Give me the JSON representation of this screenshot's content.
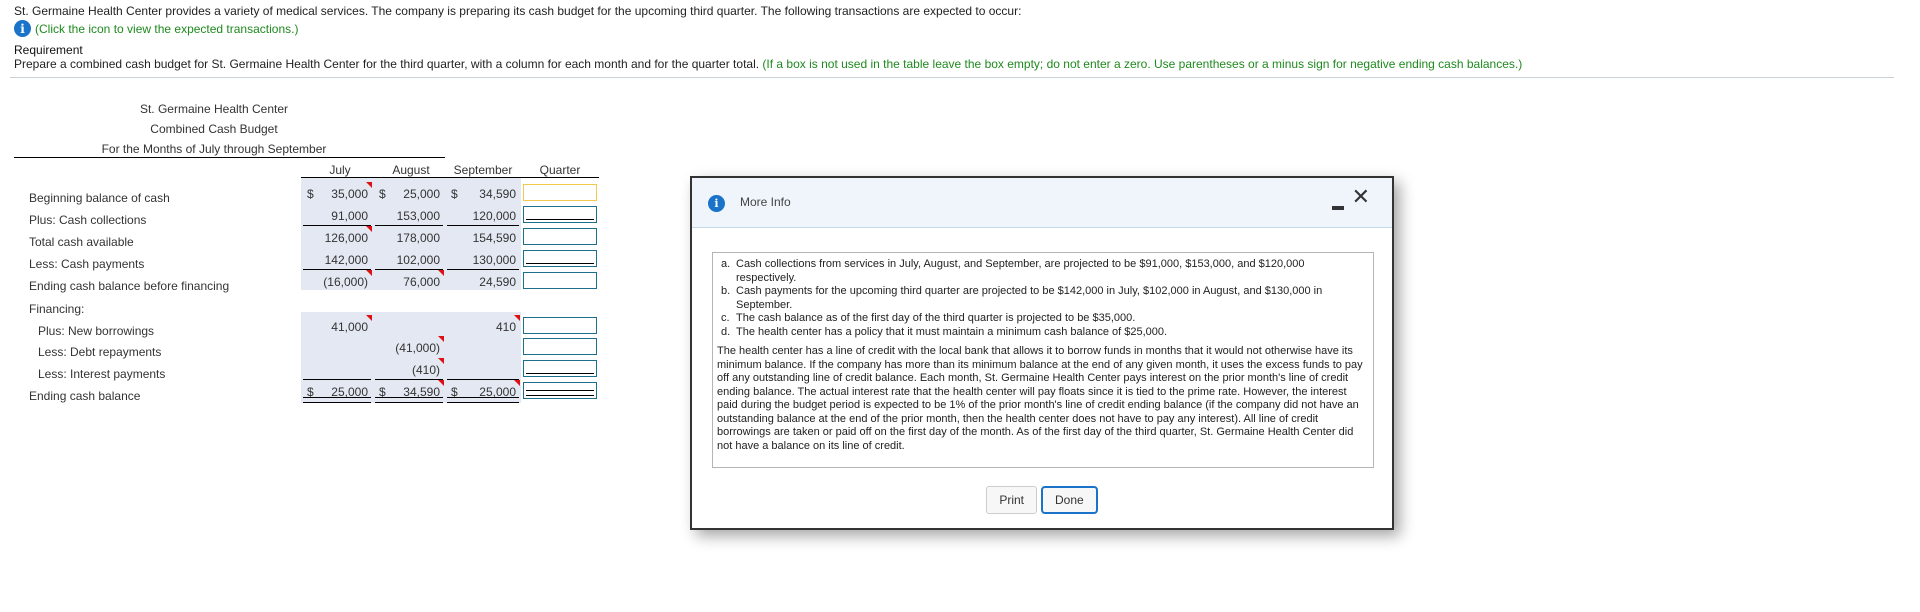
{
  "intro": {
    "text": "St. Germaine Health Center provides a variety of medical services. The company is preparing its cash budget for the upcoming third quarter. The following transactions are expected to occur:",
    "click_icon_text": "(Click the icon to view the expected transactions.)",
    "info_icon": "info-icon"
  },
  "requirement": {
    "title": "Requirement",
    "text": "Prepare a combined cash budget for St. Germaine Health Center for the third quarter, with a column for each month and for the quarter total.",
    "instruction": "(If a box is not used in the table leave the box empty; do not enter a zero. Use parentheses or a minus sign for negative ending cash balances.)",
    "accent_color": "#1e8a1e"
  },
  "budget": {
    "title1": "St. Germaine Health Center",
    "title2": "Combined Cash Budget",
    "title3": "For the Months of July through September",
    "columns": [
      "July",
      "August",
      "September",
      "Quarter"
    ],
    "rows": [
      {
        "label": "Beginning balance of cash",
        "dollar": true,
        "values": [
          "35,000",
          "25,000",
          "34,590"
        ],
        "quarter": ""
      },
      {
        "label": "Plus: Cash collections",
        "dollar": false,
        "values": [
          "91,000",
          "153,000",
          "120,000"
        ],
        "quarter": ""
      },
      {
        "label": "Total cash available",
        "dollar": false,
        "values": [
          "126,000",
          "178,000",
          "154,590"
        ],
        "quarter": ""
      },
      {
        "label": "Less: Cash payments",
        "dollar": false,
        "values": [
          "142,000",
          "102,000",
          "130,000"
        ],
        "quarter": ""
      },
      {
        "label": "Ending cash balance before financing",
        "dollar": false,
        "values": [
          "(16,000)",
          "76,000",
          "24,590"
        ],
        "quarter": ""
      },
      {
        "label": "Financing:"
      },
      {
        "label": "Plus: New borrowings",
        "dollar": false,
        "values": [
          "41,000",
          "",
          "410"
        ],
        "quarter": ""
      },
      {
        "label": "Less: Debt repayments",
        "dollar": false,
        "values": [
          "",
          "(41,000)",
          ""
        ],
        "quarter": ""
      },
      {
        "label": "Less: Interest payments",
        "dollar": false,
        "values": [
          "",
          "(410)",
          ""
        ],
        "quarter": ""
      },
      {
        "label": "Ending cash balance",
        "dollar": true,
        "values": [
          "25,000",
          "34,590",
          "25,000"
        ],
        "quarter": ""
      }
    ],
    "currency_symbol": "$",
    "shade_color": "#e3e8f2",
    "flag_color": "#dd1111"
  },
  "modal": {
    "title": "More Info",
    "items": [
      {
        "marker": "a.",
        "text": "Cash collections from services in July, August, and September, are projected to be $91,000, $153,000, and $120,000 respectively."
      },
      {
        "marker": "b.",
        "text": "Cash payments for the upcoming third quarter are projected to be $142,000 in July, $102,000 in August, and $130,000 in September."
      },
      {
        "marker": "c.",
        "text": "The cash balance as of the first day of the third quarter is projected to be $35,000."
      },
      {
        "marker": "d.",
        "text": "The health center has a policy that it must maintain a minimum cash balance of $25,000."
      }
    ],
    "paragraph": "The health center has a line of credit with the local bank that allows it to borrow funds in months that it would not otherwise have its minimum balance. If the company has more than its minimum balance at the end of any given month, it uses the excess funds to pay off any outstanding line of credit balance. Each month, St. Germaine Health Center pays interest on the prior month's line of credit ending balance. The actual interest rate that the health center will pay floats since it is tied to the prime rate. However, the interest paid during the budget period is expected to be 1% of the prior month's line of credit ending balance (if the company did not have an outstanding balance at the end of the prior month, then the health center does not have to pay any interest). All line of credit borrowings are taken or paid off on the first day of the month. As of the first day of the third quarter, St. Germaine Health Center did not have a balance on its line of credit.",
    "print_label": "Print",
    "done_label": "Done",
    "minimize_icon": "minimize-icon",
    "close_icon": "close-icon"
  }
}
